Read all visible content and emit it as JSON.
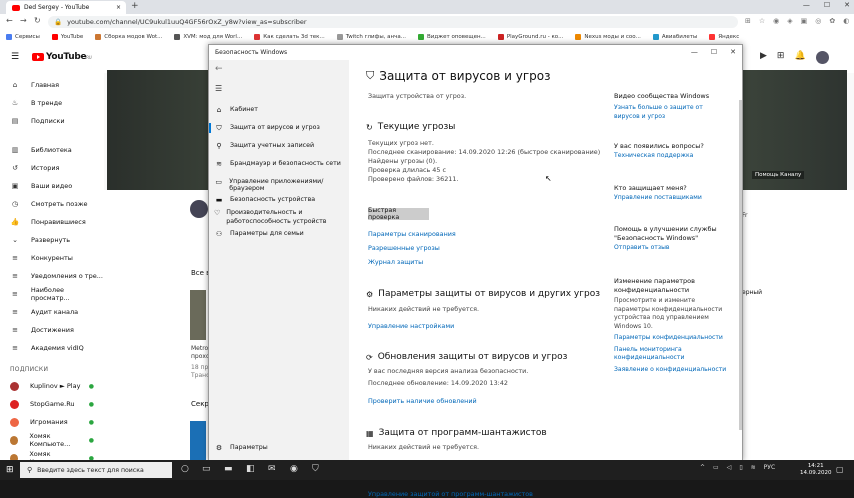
{
  "chrome": {
    "tab_title": "Ded Sergey - YouTube",
    "tab_close": "×",
    "new_tab": "+",
    "url": "youtube.com/channel/UC9ukul1uuQ4GF56rOxZ_y8w?view_as=subscriber",
    "bookmarks": [
      "Сервисы",
      "YouTube",
      "Сборка модов Wot...",
      "XVM: мод для Worl...",
      "Как сделать 3d тек...",
      "Twitch глифы, анча...",
      "Виджет оповещен...",
      "PlayGround.ru - ко...",
      "Nexus моды и соо...",
      "Авиабилеты",
      "Яндекс"
    ]
  },
  "youtube": {
    "logo": "YouTube",
    "logo_sup": "RU",
    "sidebar": [
      "Главная",
      "В тренде",
      "Подписки",
      "Библиотека",
      "История",
      "Ваши видео",
      "Смотреть позже",
      "Понравившиеся",
      "Развернуть",
      "Конкуренты",
      "Уведомления о тре...",
      "Наиболее просматр...",
      "Аудит канала",
      "Достижения",
      "Академия vidIQ"
    ],
    "subs_header": "ПОДПИСКИ",
    "subs": [
      {
        "name": "Kuplinov ► Play",
        "color": "#a33"
      },
      {
        "name": "StopGame.Ru",
        "color": "#d22"
      },
      {
        "name": "Игромания",
        "color": "#e64"
      },
      {
        "name": "Хомяк Компьюте...",
        "color": "#b73"
      },
      {
        "name": "Хомяк Компьюте...",
        "color": "#b73"
      }
    ],
    "contact_button": "Помощь Каналу",
    "all_videos": "Все в",
    "video_title": "Metro",
    "video_line2": "прохо",
    "video_line3": "18 пр",
    "video_line4": "Транс",
    "section2": "Секр",
    "right_word": "ерный",
    "right_fr": "Fr"
  },
  "security": {
    "window_title": "Безопасность Windows",
    "nav": [
      "Кабинет",
      "Защита от вирусов и угроз",
      "Защита учетных записей",
      "Брандмауэр и безопасность сети",
      "Управление приложениями/браузером",
      "Безопасность устройства",
      "Производительность и работоспособность устройств",
      "Параметры для семьи"
    ],
    "nav_settings": "Параметры",
    "page_title": "Защита от вирусов и угроз",
    "page_subtitle": "Защита устройства от угроз.",
    "threats_title": "Текущие угрозы",
    "threats_lines": [
      "Текущих угроз нет.",
      "Последнее сканирование: 14.09.2020 12:26 (быстрое сканирование)",
      "Найдены угрозы (0).",
      "Проверка длилась 45 с",
      "Проверено файлов: 36211."
    ],
    "scan_button": "Быстрая проверка",
    "threat_links": [
      "Параметры сканирования",
      "Разрешенные угрозы",
      "Журнал защиты"
    ],
    "params_title": "Параметры защиты от вирусов и других угроз",
    "params_text": "Никаких действий не требуется.",
    "params_link": "Управление настройками",
    "updates_title": "Обновления защиты от вирусов и угроз",
    "updates_lines": [
      "У вас последняя версия анализа безопасности.",
      "Последнее обновление: 14.09.2020 13:42"
    ],
    "updates_link": "Проверить наличие обновлений",
    "ransom_title": "Защита от программ-шантажистов",
    "ransom_text": "Никаких действий не требуется.",
    "ransom_link": "Управление защитой от программ-шантажистов",
    "right": {
      "community_title": "Видео сообщества Windows",
      "community_link": "Узнать больше о защите от вирусов и угроз",
      "questions_title": "У вас появились вопросы?",
      "questions_link": "Техническая поддержка",
      "who_title": "Кто защищает меня?",
      "who_link": "Управление поставщиками",
      "help_title": "Помощь в улучшении службы \"Безопасность Windows\"",
      "help_link": "Отправить отзыв",
      "privacy_title": "Изменение параметров конфиденциальности",
      "privacy_text": "Просмотрите и измените параметры конфиденциальности устройства под управлением Windows 10.",
      "privacy_links": [
        "Параметры конфиденциальности",
        "Панель мониторинга конфиденциальности",
        "Заявление о конфиденциальности"
      ]
    }
  },
  "taskbar": {
    "search_placeholder": "Введите здесь текст для поиска",
    "lang": "РУС",
    "time": "14:21",
    "date": "14.09.2020"
  }
}
